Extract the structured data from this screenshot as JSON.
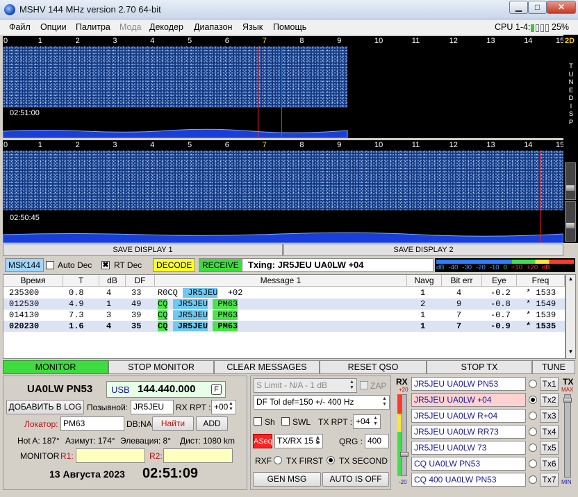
{
  "window": {
    "title": "MSHV 144 MHz version 2.70 64-bit",
    "minimize": "▁",
    "maximize": "□",
    "close": "✕"
  },
  "menu": [
    "Файл",
    "Опции",
    "Палитра",
    "Мода",
    "Декодер",
    "Диапазон",
    "Язык",
    "Помощь"
  ],
  "cpu": {
    "label": "CPU 1-4:",
    "value": "25%"
  },
  "ruler": [
    "0",
    "1",
    "2",
    "3",
    "4",
    "5",
    "6",
    "7",
    "8",
    "9",
    "10",
    "11",
    "12",
    "13",
    "14",
    "15"
  ],
  "waterfall": [
    {
      "time": "02:51:00"
    },
    {
      "time": "02:50:45"
    }
  ],
  "sidebar": {
    "label_2d": "2D",
    "vertical": [
      "T",
      "U",
      "N",
      "E",
      "",
      "D",
      "I",
      "S",
      "P"
    ]
  },
  "save": {
    "display1": "SAVE DISPLAY 1",
    "display2": "SAVE DISPLAY 2"
  },
  "toolbar": {
    "mode": "MSK144",
    "auto_dec": "Auto Dec",
    "rt_dec": "RT Dec",
    "decode": "DECODE",
    "receive": "RECEIVE",
    "txing": "Txing: JR5JEU UA0LW +04",
    "meter_labels": [
      "dB",
      "-40",
      "-30",
      "-20",
      "-10",
      "0",
      "+10",
      "+20",
      "dB"
    ]
  },
  "table": {
    "headers": [
      "Время",
      "T",
      "dB",
      "DF",
      "Message 1",
      "Navg",
      "Bit err",
      "Eye",
      "Freq"
    ],
    "rows": [
      {
        "time": "235300",
        "t": "0.8",
        "db": "4",
        "df": "33",
        "msg": [
          "R0CQ",
          "",
          " JR5JEU",
          "b",
          " +02",
          ""
        ],
        "navg": "1",
        "biterr": "4",
        "eye": "-0.2",
        "freq": "* 1533"
      },
      {
        "time": "012530",
        "t": "4.9",
        "db": "1",
        "df": "49",
        "msg": [
          "CQ",
          "g",
          " JR5JEU",
          "b",
          " PM63",
          "g"
        ],
        "navg": "2",
        "biterr": "9",
        "eye": "-0.8",
        "freq": "* 1549"
      },
      {
        "time": "014130",
        "t": "7.3",
        "db": "3",
        "df": "39",
        "msg": [
          "CQ",
          "g",
          " JR5JEU",
          "b",
          " PM63",
          "g"
        ],
        "navg": "1",
        "biterr": "7",
        "eye": "-0.7",
        "freq": "* 1539"
      },
      {
        "time": "020230",
        "t": "1.6",
        "db": "4",
        "df": "35",
        "msg": [
          "CQ",
          "g",
          " JR5JEU",
          "b",
          " PM63",
          "g"
        ],
        "navg": "1",
        "biterr": "7",
        "eye": "-0.9",
        "freq": "* 1535"
      }
    ]
  },
  "buttons": {
    "monitor": "MONITOR",
    "stop_monitor": "STOP MONITOR",
    "clear": "CLEAR MESSAGES",
    "reset_qso": "RESET QSO",
    "stop_tx": "STOP TX",
    "tune": "TUNE"
  },
  "station": {
    "call_loc": "UA0LW PN53",
    "mode": "USB",
    "freq": "144.440.000",
    "f_btn": "F",
    "add_log": "ДОБАВИТЬ В LOG",
    "callsign_label": "Позывной:",
    "callsign": "JR5JEU",
    "rxrpt_label": "RX RPT :",
    "rxrpt": "+00",
    "locator_label": "Локатор:",
    "locator": "PM63",
    "db_label": "DB:NA",
    "find": "Найти",
    "add": "ADD",
    "hot": "Hot A: 187°",
    "azimuth": "Азимут: 174°",
    "elev": "Элевация: 8°",
    "dist": "Дист: 1080 km",
    "monitor_label": "MONITOR",
    "r1": "R1:",
    "r2": "R2:",
    "date": "13 Августа 2023",
    "time": "02:51:09"
  },
  "middle": {
    "slimit": "S Limit - N/A - 1  dB",
    "zap": "ZAP",
    "dftol": "DF Tol def=150 +/-  400  Hz",
    "sh": "Sh",
    "swl": "SWL",
    "txrpt_label": "TX RPT :",
    "txrpt": "+04",
    "aseq": "ASeq",
    "txrx": "TX/RX 15  s",
    "qrg_label": "QRG :",
    "qrg": "400",
    "rxf": "RXF",
    "tx_first": "TX FIRST",
    "tx_second": "TX SECOND",
    "gen_msg": "GEN MSG",
    "auto_off": "AUTO IS OFF"
  },
  "rx": {
    "label": "RX",
    "top": "+20",
    "bottom": "-20"
  },
  "tx": {
    "label": "TX",
    "max": "MAX",
    "min": "MIN"
  },
  "messages": [
    {
      "text": "JR5JEU UA0LW PN53",
      "btn": "Tx1"
    },
    {
      "text": "JR5JEU UA0LW +04",
      "btn": "Tx2"
    },
    {
      "text": "JR5JEU UA0LW R+04",
      "btn": "Tx3"
    },
    {
      "text": "JR5JEU UA0LW RR73",
      "btn": "Tx4"
    },
    {
      "text": "JR5JEU UA0LW 73",
      "btn": "Tx5"
    },
    {
      "text": "CQ UA0LW PN53",
      "btn": "Tx6"
    },
    {
      "text": "CQ 400 UA0LW PN53",
      "btn": "Tx7"
    }
  ],
  "selected_tx": 2
}
